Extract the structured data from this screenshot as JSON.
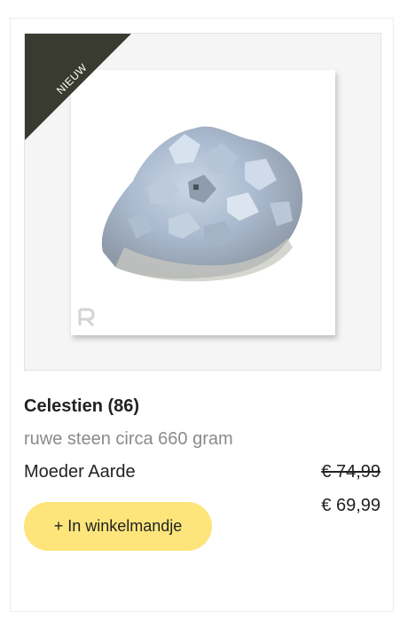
{
  "product": {
    "badge": "NIEUW",
    "title": "Celestien (86)",
    "subtitle": "ruwe steen circa 660 gram",
    "brand": "Moeder Aarde",
    "old_price": "€ 74,99",
    "new_price": "€ 69,99",
    "cart_button": "+ In winkelmandje",
    "watermark_icon": "brand-logo-icon"
  },
  "colors": {
    "ribbon": "#3a3b30",
    "button": "#fde57b",
    "subtitle": "#8a8a8a"
  }
}
